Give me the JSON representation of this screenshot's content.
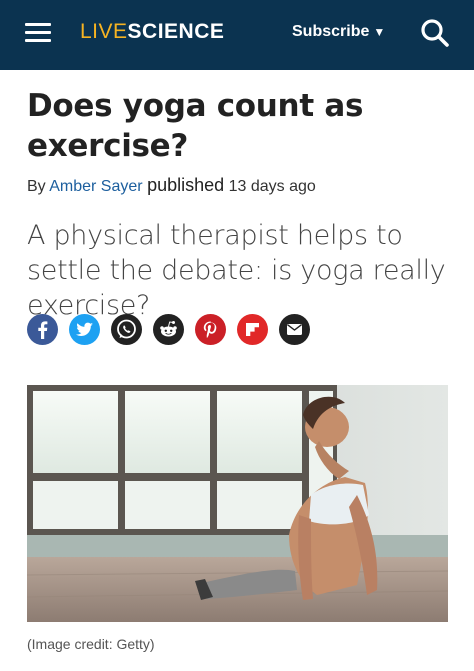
{
  "header": {
    "logo_live": "LIVE",
    "logo_science": "SCIENCE",
    "subscribe_label": "Subscribe",
    "background_color": "#0b3350",
    "logo_accent_color": "#f6b322"
  },
  "article": {
    "title": "Does yoga count as exercise?",
    "byline_prefix": "By",
    "author": "Amber Sayer",
    "published_label": "published",
    "published_ago": "13 days ago",
    "strapline": "A physical therapist helps to settle the debate: is yoga really exercise?",
    "image_credit": "(Image credit: Getty)"
  },
  "share_buttons": [
    {
      "icon": "facebook-icon",
      "color": "#3b5998"
    },
    {
      "icon": "twitter-icon",
      "color": "#1da1f2"
    },
    {
      "icon": "whatsapp-icon",
      "color": "#222222"
    },
    {
      "icon": "reddit-icon",
      "color": "#222222"
    },
    {
      "icon": "pinterest-icon",
      "color": "#cb2027"
    },
    {
      "icon": "flipboard-icon",
      "color": "#e12828"
    },
    {
      "icon": "email-icon",
      "color": "#222222"
    }
  ]
}
